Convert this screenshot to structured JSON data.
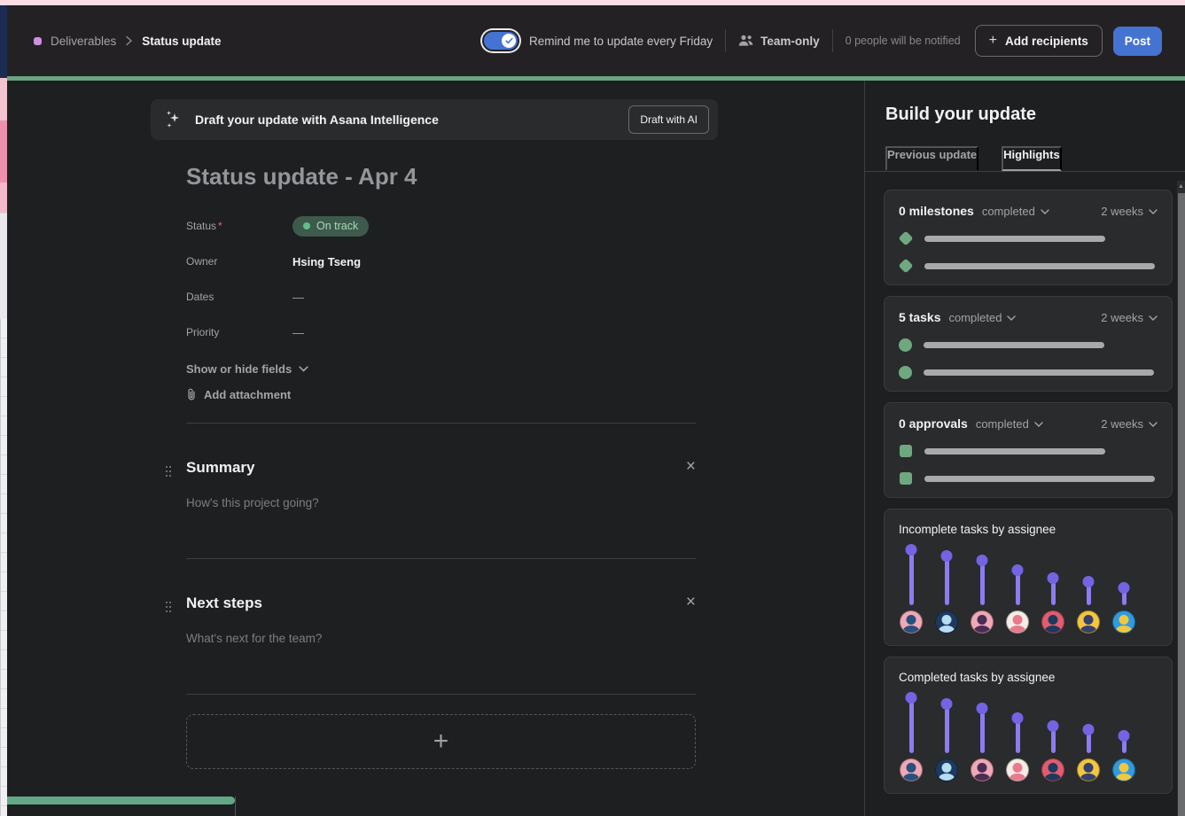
{
  "header": {
    "breadcrumb": {
      "project": "Deliverables",
      "page": "Status update"
    },
    "reminder": {
      "label": "Remind me to update every Friday",
      "enabled": true
    },
    "privacy_label": "Team-only",
    "notify_text": "0 people will be notified",
    "add_recipients_label": "Add recipients",
    "post_label": "Post"
  },
  "ai_banner": {
    "message": "Draft your update with Asana Intelligence",
    "button_label": "Draft with AI"
  },
  "form": {
    "title": "Status update - Apr 4",
    "fields": [
      {
        "label": "Status",
        "required": "*",
        "value": "On track"
      },
      {
        "label": "Owner",
        "value": "Hsing Tseng"
      },
      {
        "label": "Dates",
        "value": "—"
      },
      {
        "label": "Priority",
        "value": "—"
      }
    ],
    "show_or_hide_label": "Show or hide fields",
    "add_attachment_label": "Add attachment",
    "sections": [
      {
        "heading": "Summary",
        "placeholder": "How's this project going?"
      },
      {
        "heading": "Next steps",
        "placeholder": "What's next for the team?"
      }
    ],
    "add_section_label": "+"
  },
  "sidebar": {
    "title": "Build your update",
    "tabs": [
      {
        "label": "Previous update"
      },
      {
        "label": "Highlights"
      }
    ],
    "active_tab": "Highlights",
    "stat_cards": [
      {
        "count": "0 milestones",
        "filter": "completed",
        "range": "2 weeks",
        "icon": "milestone-diamond",
        "bar_widths": [
          "70%",
          "89%"
        ]
      },
      {
        "count": "5 tasks",
        "filter": "completed",
        "range": "2 weeks",
        "icon": "task-circle",
        "bar_widths": [
          "70%",
          "89%"
        ]
      },
      {
        "count": "0 approvals",
        "filter": "completed",
        "range": "2 weeks",
        "icon": "approval-square",
        "bar_widths": [
          "70%",
          "89%"
        ]
      }
    ],
    "charts": [
      {
        "title": "Incomplete tasks by assignee",
        "type": "lollipop",
        "values": [
          68,
          61,
          56,
          45,
          36,
          32,
          25
        ]
      },
      {
        "title": "Completed tasks by assignee",
        "type": "lollipop",
        "values": [
          68,
          61,
          56,
          45,
          36,
          32,
          25
        ]
      }
    ],
    "assignee_avatars": [
      {
        "bg": "#F0A8B6",
        "fg": "#27507E"
      },
      {
        "bg": "#1C3A5E",
        "fg": "#B7DCF4"
      },
      {
        "bg": "#F0A8B6",
        "fg": "#4A2D55"
      },
      {
        "bg": "#F3EDE6",
        "fg": "#E9798C"
      },
      {
        "bg": "#E25C70",
        "fg": "#1C3A5E"
      },
      {
        "bg": "#F2C63F",
        "fg": "#35406B"
      },
      {
        "bg": "#2F9BE0",
        "fg": "#F2C63F"
      }
    ]
  },
  "colors": {
    "accent_blue": "#4573D2",
    "top_green_bar": "#68A47F",
    "status_on_track_bg": "#3D5A4C",
    "status_on_track_text": "#A8D9B8",
    "chart_purple": "#8B7CF0",
    "green_icon": "#6FA87F",
    "breadcrumb_dot": "#CD90E2"
  }
}
